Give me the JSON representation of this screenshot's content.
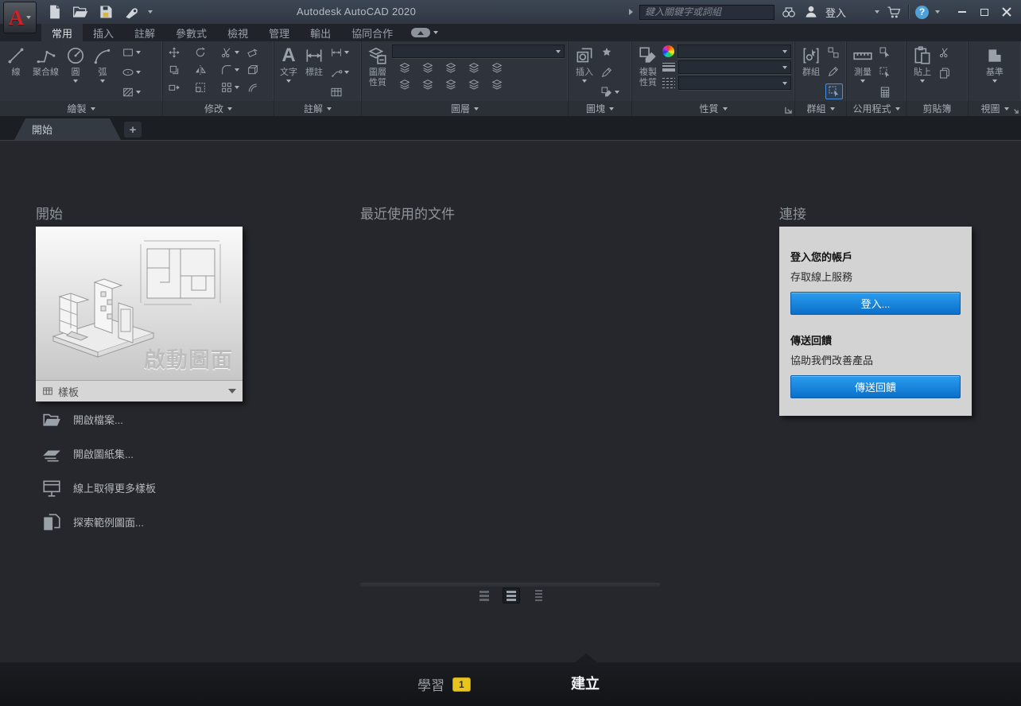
{
  "icons": {
    "plus": "+",
    "caret_down": "css-triangle-down",
    "title_arrow": "css-triangle-right",
    "minimize": "bar-shape",
    "maximize": "square-shape",
    "close": "x-shape"
  },
  "titlebar": {
    "title": "Autodesk AutoCAD 2020",
    "search_placeholder": "鍵入關鍵字或詞組",
    "signin_label": "登入"
  },
  "ribbon": {
    "tabs": [
      "常用",
      "插入",
      "註解",
      "參數式",
      "檢視",
      "管理",
      "輸出",
      "協同合作"
    ],
    "panels": {
      "draw": {
        "label": "繪製",
        "line": "線",
        "polyline": "聚合線",
        "circle": "圓",
        "arc": "弧"
      },
      "modify": {
        "label": "修改"
      },
      "annotate": {
        "label": "註解",
        "text": "文字",
        "dimension": "標註"
      },
      "layers": {
        "label": "圖層",
        "props_line1": "圖層",
        "props_line2": "性質"
      },
      "block": {
        "label": "圖塊",
        "insert": "插入"
      },
      "properties": {
        "label": "性質",
        "match_line1": "複製",
        "match_line2": "性質"
      },
      "groups": {
        "label": "群組",
        "group": "群組"
      },
      "utilities": {
        "label": "公用程式",
        "measure": "測量"
      },
      "clipboard": {
        "label": "剪貼簿",
        "paste": "貼上"
      },
      "view": {
        "label": "視圖",
        "base": "基準"
      }
    }
  },
  "file_tabs": {
    "start": "開始"
  },
  "start_page": {
    "start": {
      "header": "開始",
      "card_title": "啟動圖面",
      "template_label": "樣板",
      "links": [
        {
          "label": "開啟檔案..."
        },
        {
          "label": "開啟圖紙集..."
        },
        {
          "label": "線上取得更多樣板"
        },
        {
          "label": "探索範例圖面..."
        }
      ]
    },
    "recent": {
      "header": "最近使用的文件"
    },
    "connect": {
      "header": "連接",
      "signin_title": "登入您的帳戶",
      "signin_desc": "存取線上服務",
      "signin_button": "登入...",
      "feedback_title": "傳送回饋",
      "feedback_desc": "協助我們改善產品",
      "feedback_button": "傳送回饋"
    }
  },
  "footer": {
    "learn": "學習",
    "learn_badge": "1",
    "create": "建立"
  },
  "colors": {
    "accent_blue": "#0e82d6",
    "badge_yellow": "#e9c51c",
    "logo_red": "#c8242b",
    "selection_blue": "#4a90d9",
    "card_gray": "#d3d3d3"
  }
}
